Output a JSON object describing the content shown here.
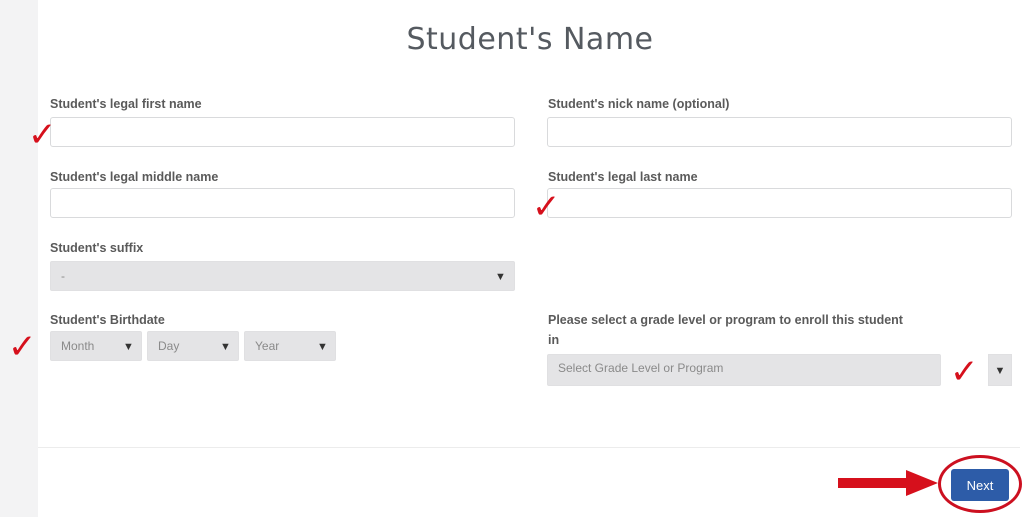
{
  "form": {
    "title": "Student's Name",
    "first_name": {
      "label": "Student's legal first name",
      "value": ""
    },
    "nick_name": {
      "label": "Student's nick name (optional)",
      "value": ""
    },
    "middle_name": {
      "label": "Student's legal middle name",
      "value": ""
    },
    "last_name": {
      "label": "Student's legal last name",
      "value": ""
    },
    "suffix": {
      "label": "Student's suffix",
      "selected": "-"
    },
    "birthdate": {
      "label": "Student's Birthdate",
      "month": "Month",
      "day": "Day",
      "year": "Year"
    },
    "grade": {
      "label_line1": "Please select a grade level or program to enroll this student",
      "label_line2": "in",
      "selected": "Select Grade Level or Program"
    },
    "next_label": "Next"
  },
  "annotations": {
    "check_glyph": "✓",
    "mark_color": "#d6101c",
    "circle_color": "#cc1020"
  },
  "icons": {
    "caret": "▼"
  },
  "colors": {
    "primary_button": "#2d5ca8",
    "select_bg": "#e4e4e6"
  }
}
